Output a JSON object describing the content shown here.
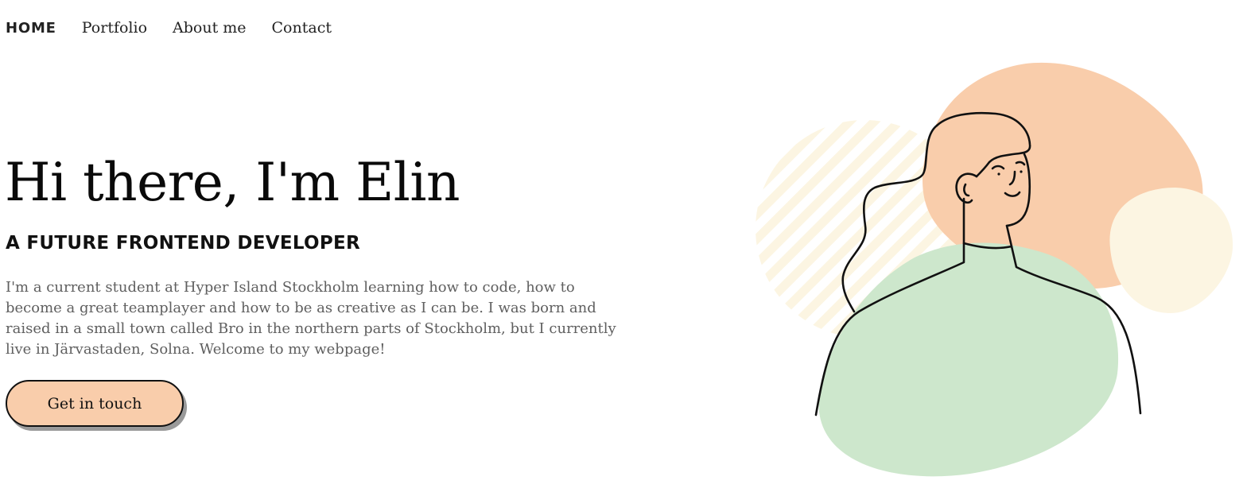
{
  "nav": {
    "items": [
      {
        "label": "HOME",
        "active": true
      },
      {
        "label": "Portfolio",
        "active": false
      },
      {
        "label": "About me",
        "active": false
      },
      {
        "label": "Contact",
        "active": false
      }
    ]
  },
  "hero": {
    "title": "Hi there, I'm Elin",
    "subtitle": "A FUTURE FRONTEND DEVELOPER",
    "description": "I'm a current student at Hyper Island Stockholm learning how to code, how to become a great teamplayer and how to be as creative as I can be. I was born and raised in a small town called Bro in the northern parts of Stockholm, but I currently live in Järvastaden, Solna. Welcome to my webpage!",
    "cta_label": "Get in touch"
  },
  "colors": {
    "peach": "#f9cdab",
    "mint": "#cde7cc",
    "cream": "#fcf5e2",
    "ink": "#111111",
    "body_text": "#5f5f5f"
  }
}
